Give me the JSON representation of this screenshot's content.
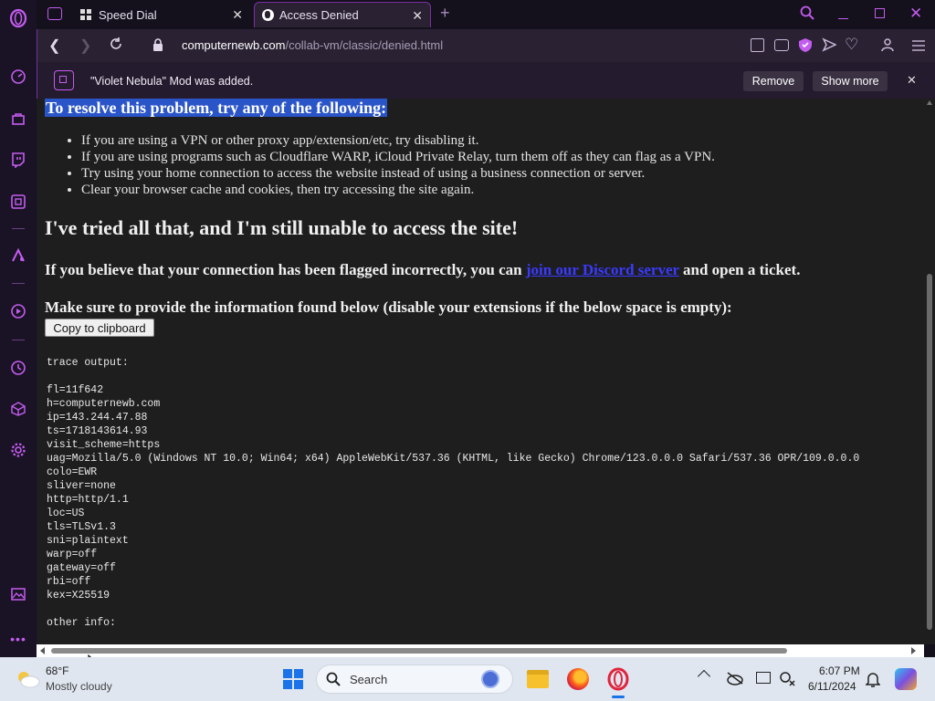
{
  "tabs": [
    {
      "label": "Speed Dial",
      "icon": "speed-dial-icon"
    },
    {
      "label": "Access Denied",
      "icon": "globe-icon"
    }
  ],
  "address": {
    "host": "computernewb.com",
    "path": "/collab-vm/classic/denied.html"
  },
  "notification": {
    "text": "\"Violet Nebula\" Mod was added.",
    "remove_label": "Remove",
    "show_more_label": "Show more"
  },
  "content": {
    "resolve_heading": "To resolve this problem, try any of the following:",
    "bullets": [
      "If you are using a VPN or other proxy app/extension/etc, try disabling it.",
      "If you are using programs such as Cloudflare WARP, iCloud Private Relay, turn them off as they can flag as a VPN.",
      "Try using your home connection to access the website instead of using a business connection or server.",
      "Clear your browser cache and cookies, then try accessing the site again."
    ],
    "tried_heading": "I've tried all that, and I'm still unable to access the site!",
    "flagged_prefix": "If you believe that your connection has been flagged incorrectly, you can ",
    "flagged_link": "join our Discord server",
    "flagged_suffix": " and open a ticket.",
    "info_heading": "Make sure to provide the information found below (disable your extensions if the below space is empty):",
    "copy_button": "Copy to clipboard",
    "trace_lines": [
      "trace output:",
      "",
      "fl=11f642",
      "h=computernewb.com",
      "ip=143.244.47.88",
      "ts=1718143614.93",
      "visit_scheme=https",
      "uag=Mozilla/5.0 (Windows NT 10.0; Win64; x64) AppleWebKit/537.36 (KHTML, like Gecko) Chrome/123.0.0.0 Safari/537.36 OPR/109.0.0.0",
      "colo=EWR",
      "sliver=none",
      "http=http/1.1",
      "loc=US",
      "tls=TLSv1.3",
      "sni=plaintext",
      "warp=off",
      "gateway=off",
      "rbi=off",
      "kex=X25519",
      "",
      "other info:"
    ]
  },
  "taskbar": {
    "weather_temp": "68°F",
    "weather_desc": "Mostly cloudy",
    "search_placeholder": "Search",
    "time": "6:07 PM",
    "date": "6/11/2024"
  },
  "colors": {
    "accent": "#c45cf0",
    "highlight": "#2a55c8",
    "link": "#3a3aff"
  }
}
